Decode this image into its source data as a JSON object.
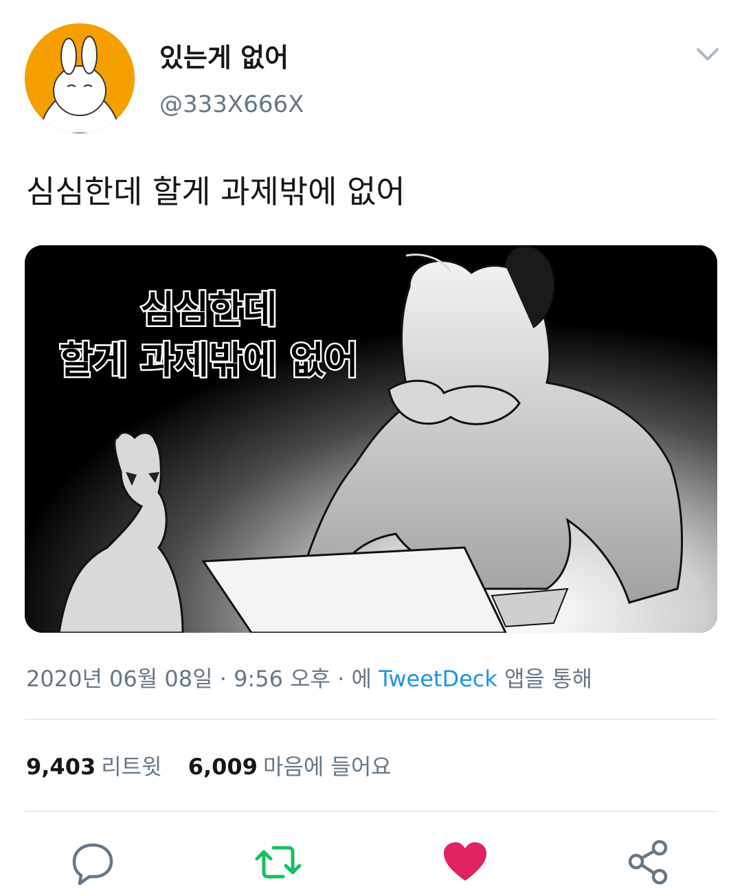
{
  "tweet": {
    "author": {
      "display_name": "있는게 없어",
      "handle": "@333X666X",
      "avatar_color": "#f5a000"
    },
    "text": "심심한데 할게 과제밖에 없어",
    "image": {
      "caption_line1": "심심한데",
      "caption_line2": "할게 과제밖에 없어"
    },
    "meta": {
      "date": "2020년 06월 08일",
      "separator1": " · ",
      "time": "9:56 오후",
      "separator2": " · ",
      "via_prefix": "에 ",
      "source": "TweetDeck",
      "via_suffix": " 앱을 통해"
    },
    "stats": {
      "retweets_count": "9,403",
      "retweets_label": "리트윗",
      "likes_count": "6,009",
      "likes_label": "마음에 들어요"
    },
    "actions": {
      "reply_icon": "speech-bubble-icon",
      "retweet_icon": "retweet-arrows-icon",
      "like_icon": "heart-icon",
      "share_icon": "share-nodes-icon"
    },
    "colors": {
      "accent_blue": "#1b95e0",
      "retweet_green": "#17bf63",
      "like_red": "#e0245e",
      "muted_gray": "#657786"
    }
  }
}
